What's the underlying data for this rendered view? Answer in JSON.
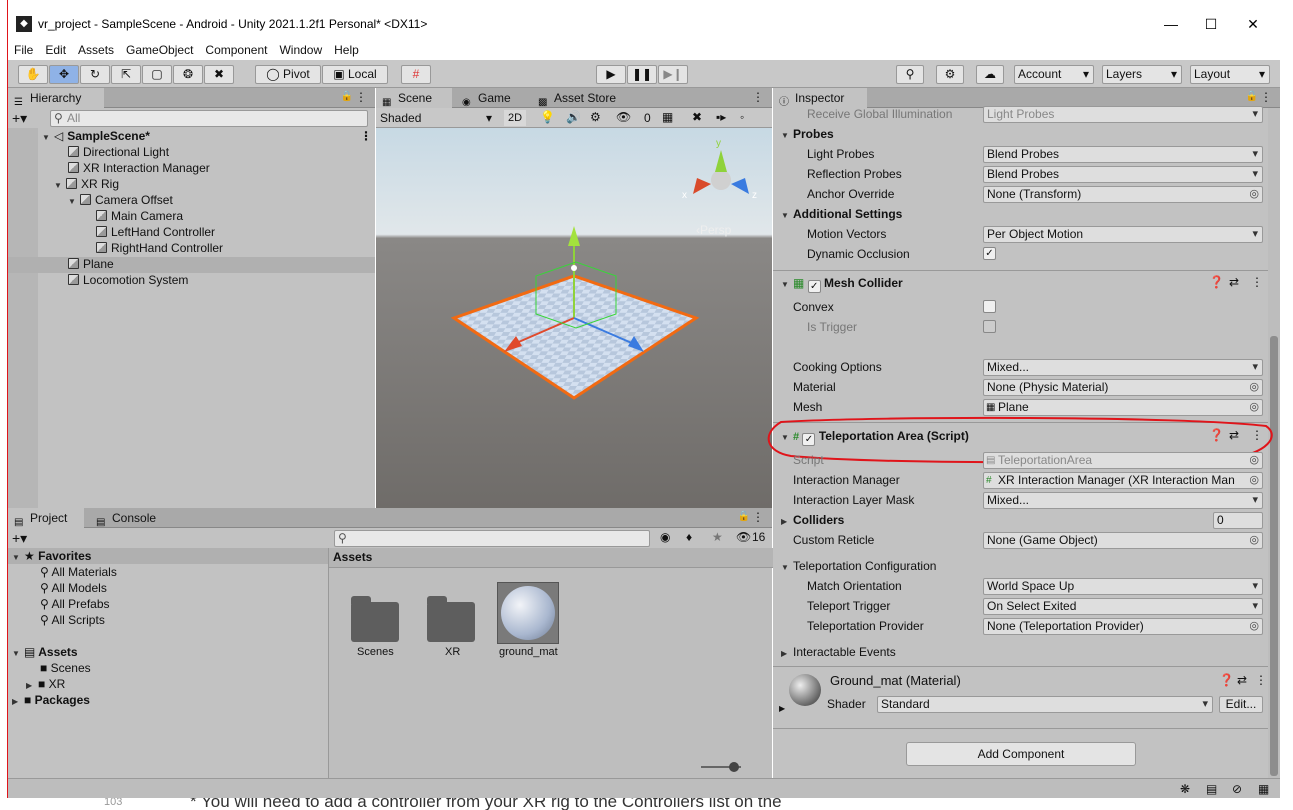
{
  "window": {
    "title": "vr_project - SampleScene - Android - Unity 2021.1.2f1 Personal* <DX11>",
    "minimize": "—",
    "maximize": "☐",
    "close": "✕"
  },
  "menu": [
    "File",
    "Edit",
    "Assets",
    "GameObject",
    "Component",
    "Window",
    "Help"
  ],
  "toolbar": {
    "pivot": "Pivot",
    "local": "Local",
    "account": "Account",
    "layers": "Layers",
    "layout": "Layout"
  },
  "hierarchy": {
    "tab": "Hierarchy",
    "search_placeholder": "All",
    "items": [
      {
        "label": "SampleScene*",
        "depth": 0
      },
      {
        "label": "Directional Light",
        "depth": 1
      },
      {
        "label": "XR Interaction Manager",
        "depth": 1
      },
      {
        "label": "XR Rig",
        "depth": 1
      },
      {
        "label": "Camera Offset",
        "depth": 2
      },
      {
        "label": "Main Camera",
        "depth": 3
      },
      {
        "label": "LeftHand Controller",
        "depth": 3
      },
      {
        "label": "RightHand Controller",
        "depth": 3
      },
      {
        "label": "Plane",
        "depth": 1
      },
      {
        "label": "Locomotion System",
        "depth": 1
      }
    ]
  },
  "scene": {
    "tabs": [
      "Scene",
      "Game",
      "Asset Store"
    ],
    "shading": "Shaded",
    "mode2d": "2D",
    "hidden_count": "0",
    "persp": "‹Persp",
    "axes": {
      "x": "x",
      "y": "y",
      "z": "z"
    }
  },
  "project": {
    "tabs": [
      "Project",
      "Console"
    ],
    "search_placeholder": "",
    "count": "16",
    "favorites_label": "Favorites",
    "favorites": [
      "All Materials",
      "All Models",
      "All Prefabs",
      "All Scripts"
    ],
    "assets_label": "Assets",
    "assets_tree": [
      "Scenes",
      "XR"
    ],
    "packages_label": "Packages",
    "breadcrumb": "Assets",
    "files": [
      "Scenes",
      "XR",
      "ground_mat"
    ]
  },
  "inspector": {
    "tab": "Inspector",
    "receive_gi": {
      "label": "Receive Global Illumination",
      "value": "Light Probes"
    },
    "probes_header": "Probes",
    "light_probes": {
      "label": "Light Probes",
      "value": "Blend Probes"
    },
    "reflection_probes": {
      "label": "Reflection Probes",
      "value": "Blend Probes"
    },
    "anchor_override": {
      "label": "Anchor Override",
      "value": "None (Transform)"
    },
    "additional_header": "Additional Settings",
    "motion_vectors": {
      "label": "Motion Vectors",
      "value": "Per Object Motion"
    },
    "dynamic_occlusion": {
      "label": "Dynamic Occlusion",
      "value": "✓"
    },
    "mesh_collider": {
      "title": "Mesh Collider",
      "convex": "Convex",
      "is_trigger": "Is Trigger",
      "cooking": {
        "label": "Cooking Options",
        "value": "Mixed..."
      },
      "material": {
        "label": "Material",
        "value": "None (Physic Material)"
      },
      "mesh": {
        "label": "Mesh",
        "value": "Plane"
      }
    },
    "teleport": {
      "title": "Teleportation Area (Script)",
      "script": {
        "label": "Script",
        "value": "TeleportationArea"
      },
      "interaction_manager": {
        "label": "Interaction Manager",
        "value": "XR Interaction Manager (XR Interaction Man"
      },
      "layer_mask": {
        "label": "Interaction Layer Mask",
        "value": "Mixed..."
      },
      "colliders": {
        "label": "Colliders",
        "value": "0"
      },
      "custom_reticle": {
        "label": "Custom Reticle",
        "value": "None (Game Object)"
      },
      "config_header": "Teleportation Configuration",
      "match_orientation": {
        "label": "Match Orientation",
        "value": "World Space Up"
      },
      "teleport_trigger": {
        "label": "Teleport Trigger",
        "value": "On Select Exited"
      },
      "teleport_provider": {
        "label": "Teleportation Provider",
        "value": "None (Teleportation Provider)"
      },
      "events": "Interactable Events"
    },
    "material": {
      "title": "Ground_mat (Material)",
      "shader_label": "Shader",
      "shader_value": "Standard",
      "edit": "Edit..."
    },
    "add_component": "Add Component"
  },
  "background_text": {
    "line_no": "103",
    "text": "* You will need to add a controller from your XR rig to the Controllers list on the"
  },
  "colors": {
    "highlight": "#e0141a",
    "selection_outline": "#f26a12",
    "accent": "#8fb2e6"
  }
}
